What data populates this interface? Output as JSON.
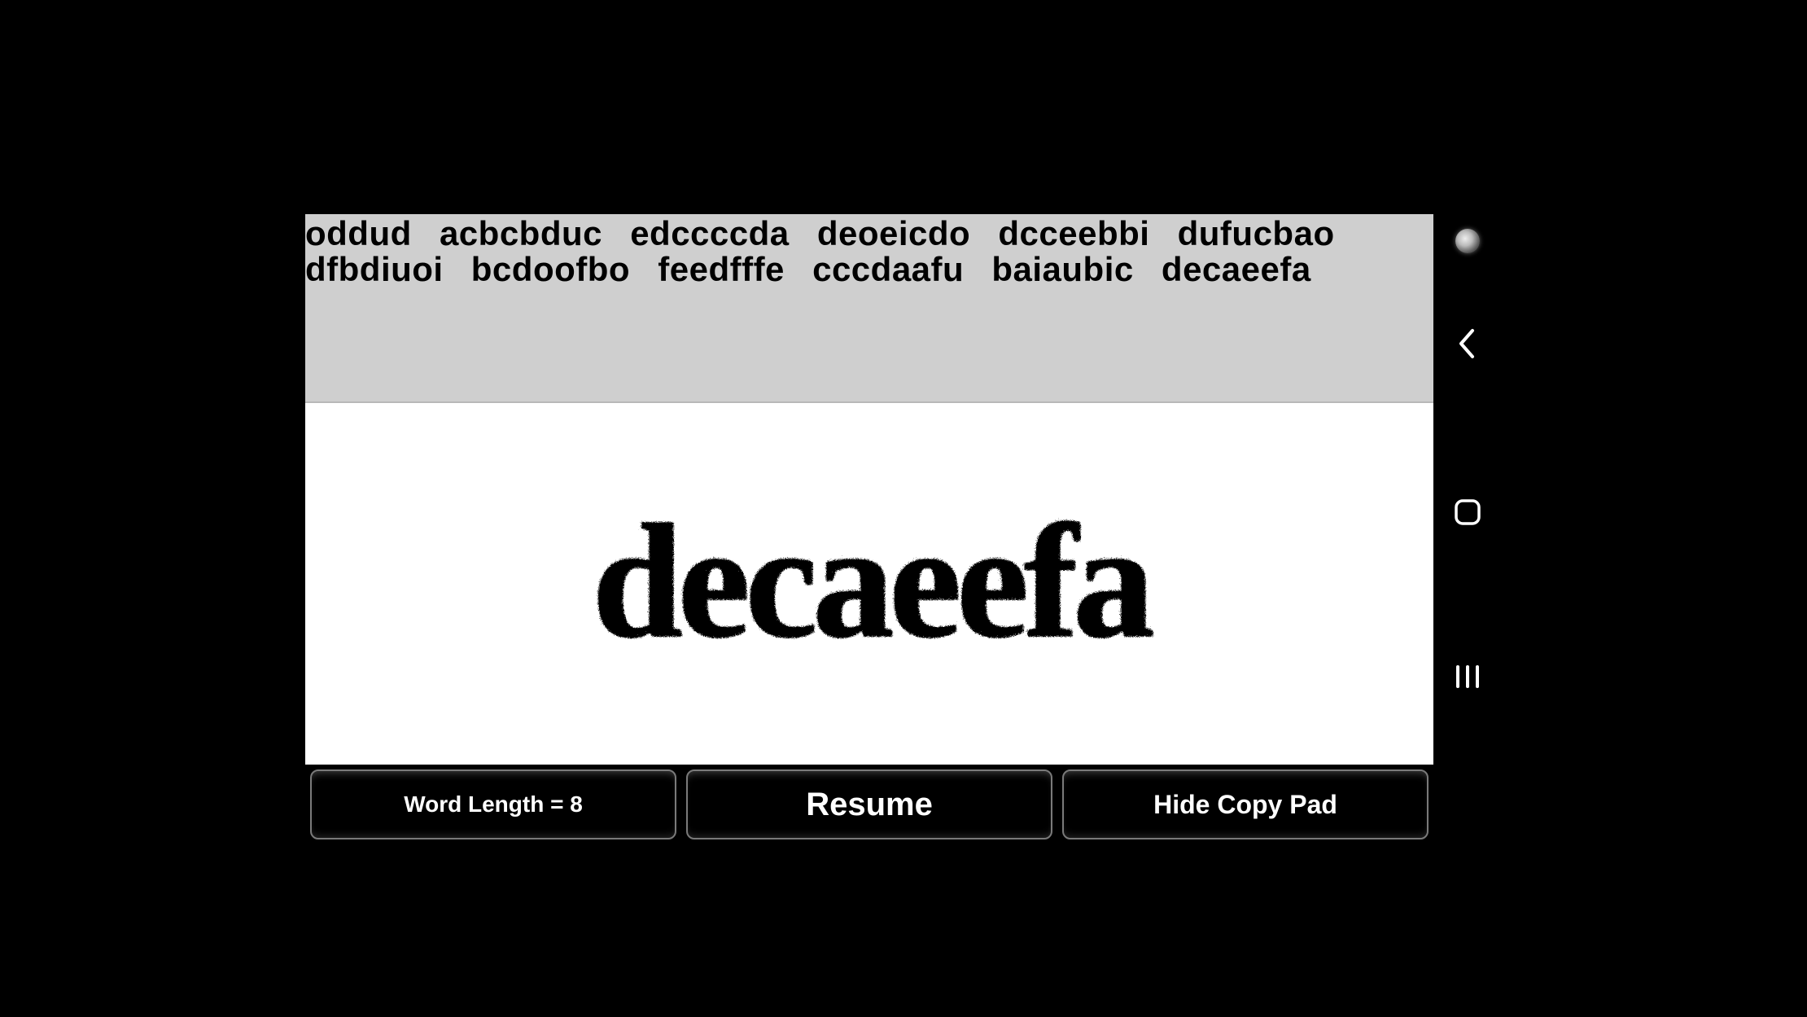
{
  "words_strip": {
    "words": [
      "oddud",
      "acbcbduc",
      "edccccda",
      "deoeicdo",
      "dcceebbi",
      "dufucbao",
      "dfbdiuoi",
      "bcdoofbo",
      "feedfffe",
      "cccdaafu",
      "baiaubic",
      "decaeefa"
    ]
  },
  "canvas": {
    "handwritten_word": "decaeefa"
  },
  "buttons": {
    "word_length_label": "Word Length = 8",
    "resume_label": "Resume",
    "hide_copy_pad_label": "Hide Copy Pad"
  },
  "nav": {
    "back_icon": "back-icon",
    "home_icon": "home-icon",
    "recents_icon": "recents-icon",
    "camera_icon": "camera-icon"
  }
}
